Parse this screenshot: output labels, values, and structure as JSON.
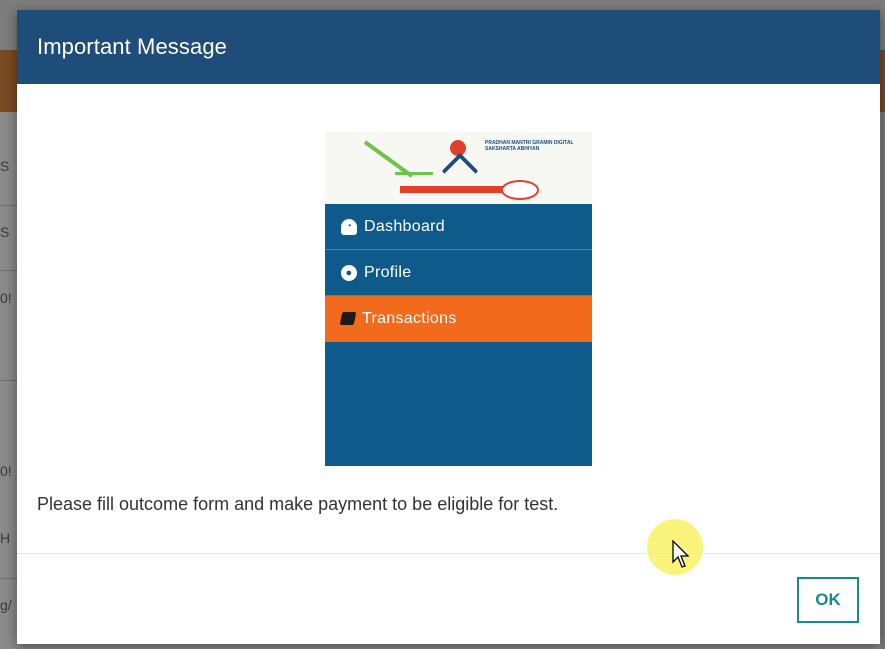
{
  "background": {
    "row_snippets": [
      "S",
      "S",
      "0!",
      "0!",
      "H",
      "g/"
    ]
  },
  "modal": {
    "title": "Important Message",
    "message": "Please fill outcome form and make payment to be eligible for test.",
    "ok_label": "OK",
    "header_color": "#1d4d78",
    "accent_color": "#178a8a"
  },
  "embedded_screenshot": {
    "logo_text": "PRADHAN MANTRI GRAMIN DIGITAL SAKSHARTA ABHIYAN",
    "nav_items": [
      {
        "label": "Dashboard",
        "icon": "dashboard-icon",
        "active": false
      },
      {
        "label": "Profile",
        "icon": "profile-icon",
        "active": false
      },
      {
        "label": "Transactions",
        "icon": "book-icon",
        "active": true
      }
    ],
    "nav_color": "#0e5a8a",
    "active_color": "#f26b1d"
  }
}
